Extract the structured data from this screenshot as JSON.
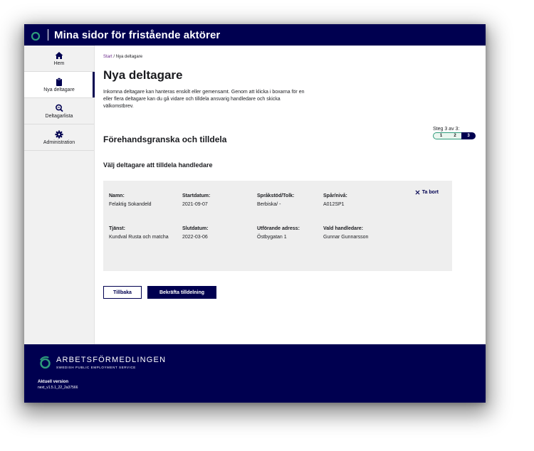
{
  "app": {
    "title": "Mina sidor för fristående aktörer"
  },
  "sidebar": {
    "items": [
      {
        "label": "Hem",
        "icon": "home-icon"
      },
      {
        "label": "Nya deltagare",
        "icon": "clipboard-icon"
      },
      {
        "label": "Deltagarlista",
        "icon": "search-list-icon"
      },
      {
        "label": "Administration",
        "icon": "gear-icon"
      }
    ]
  },
  "breadcrumb": {
    "link": "Start",
    "separator": "/",
    "current": "Nya deltagare"
  },
  "main": {
    "title": "Nya deltagare",
    "intro": "Inkomna deltagare kan hanteras enskilt eller gemensamt. Genom att klicka i boxarna för en eller flera deltagare kan du gå vidare och tilldela ansvarig handledare och skicka välkomstbrev.",
    "section_title": "Förehandsgranska och tilldela",
    "subtitle": "Välj deltagare att tilldela handledare"
  },
  "stepper": {
    "text": "Steg 3 av 3:",
    "steps": [
      "1",
      "2",
      "3"
    ],
    "current": 3
  },
  "card": {
    "remove_label": "Ta bort",
    "fields": [
      {
        "label": "Namn:",
        "value": "Felaktig Sokandeld"
      },
      {
        "label": "Startdatum:",
        "value": "2021-09-07"
      },
      {
        "label": "Språkstöd/Tolk:",
        "value": "Berbiska/ -"
      },
      {
        "label": "Spår/nivå:",
        "value": "A012SP1"
      },
      {
        "label": "Tjänst:",
        "value": "Kundval Rusta och matcha"
      },
      {
        "label": "Slutdatum:",
        "value": "2022-03-06"
      },
      {
        "label": "Utförande adress:",
        "value": "Östbygatan 1"
      },
      {
        "label": "Vald handledare:",
        "value": "Gunnar Gunnarsson"
      }
    ]
  },
  "buttons": {
    "back": "Tillbaka",
    "confirm": "Bekräfta tilldelning"
  },
  "footer": {
    "brand": "ARBETSFÖRMEDLINGEN",
    "brand_sub": "SWEDISH PUBLIC EMPLOYMENT SERVICE",
    "version_label": "Aktuell version",
    "version_value": "next_v1.5.1_22_2a37566"
  },
  "colors": {
    "primary": "#000050",
    "accent_green": "#2e9b7b",
    "link_purple": "#6c2c8c",
    "card_bg": "#eeeeee"
  }
}
